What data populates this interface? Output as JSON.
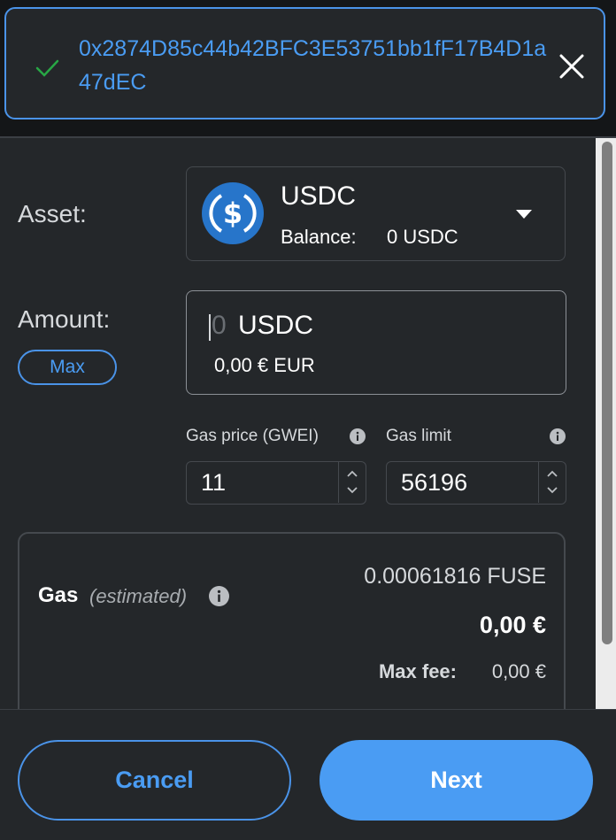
{
  "recipient": {
    "address": "0x2874D85c44b42BFC3E53751bb1fF17B4D1a47dEC"
  },
  "asset": {
    "label": "Asset:",
    "name": "USDC",
    "balance_label": "Balance:",
    "balance_value": "0 USDC",
    "icon": "usd-coin-icon",
    "icon_color": "#2775ca"
  },
  "amount": {
    "label": "Amount:",
    "max_label": "Max",
    "value": "0",
    "unit": "USDC",
    "fiat": "0,00 € EUR"
  },
  "gas_settings": {
    "price_label": "Gas price (GWEI)",
    "price_value": "11",
    "limit_label": "Gas limit",
    "limit_value": "56196"
  },
  "gas_estimate": {
    "title": "Gas",
    "estimated_label": "(estimated)",
    "native": "0.00061816 FUSE",
    "fiat": "0,00 €",
    "max_fee_label": "Max fee:",
    "max_fee_value": "0,00 €"
  },
  "footer": {
    "cancel_label": "Cancel",
    "next_label": "Next"
  },
  "colors": {
    "accent": "#4a9cf3",
    "background": "#24272a",
    "success": "#28a745"
  }
}
